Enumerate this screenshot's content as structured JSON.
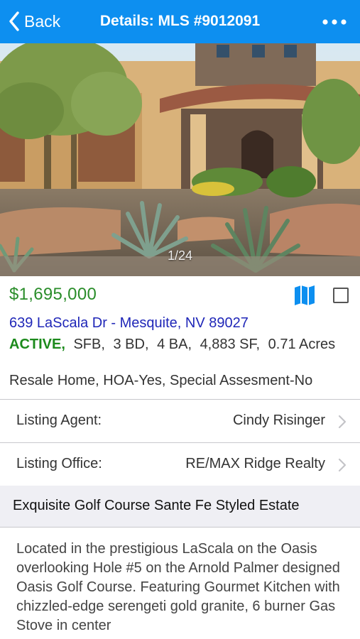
{
  "navbar": {
    "back_label": "Back",
    "title": "Details: MLS #9012091",
    "more_icon": "ellipsis-icon",
    "color": "#0d8ff0"
  },
  "photo": {
    "counter": "1/24"
  },
  "listing": {
    "price": "$1,695,000",
    "price_color": "#2a8d2a",
    "address": "639 LaScala Dr - Mesquite, NV 89027",
    "address_color": "#2027b8",
    "status": "ACTIVE,",
    "type": "SFB,",
    "beds": "3 BD,",
    "baths": "4 BA,",
    "sqft": "4,883 SF,",
    "acres": "0.71 Acres",
    "subtype": "Resale Home, HOA-Yes, Special Assesment-No",
    "map_icon": "map-icon",
    "favorite_checked": false
  },
  "agent_row": {
    "label": "Listing Agent:",
    "value": "Cindy Risinger"
  },
  "office_row": {
    "label": "Listing Office:",
    "value": "RE/MAX Ridge Realty"
  },
  "remarks": {
    "heading": "Exquisite Golf Course Sante Fe Styled Estate",
    "body": "Located in the prestigious LaScala on the Oasis overlooking Hole #5 on the Arnold Palmer designed Oasis Golf Course. Featuring Gourmet Kitchen with chizzled-edge serengeti gold granite, 6 burner Gas Stove in center"
  }
}
